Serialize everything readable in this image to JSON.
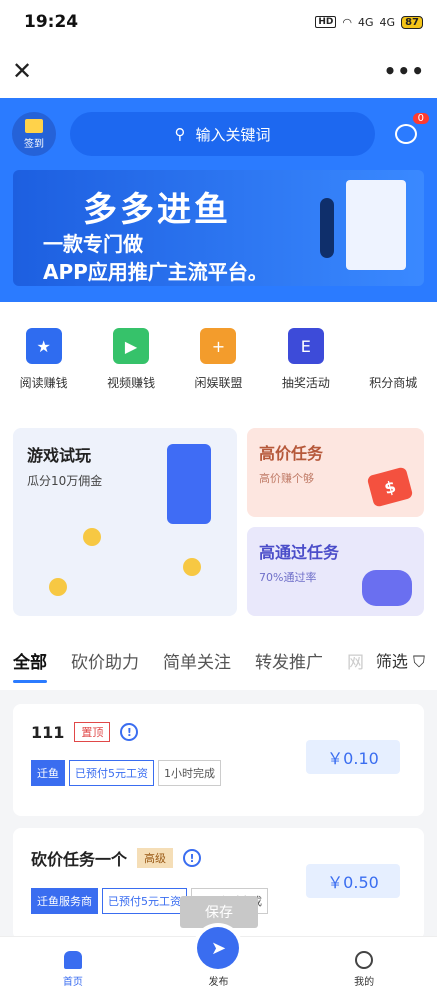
{
  "status": {
    "time": "19:24",
    "hd": "HD",
    "net1": "4G",
    "net2": "4G",
    "battery": "87"
  },
  "nav": {
    "close": "✕",
    "more": "•••"
  },
  "header": {
    "signin_label": "签到",
    "search_placeholder": "输入关键词",
    "msg_count": "0"
  },
  "banner": {
    "title": "多多进鱼",
    "line1": "一款专门做",
    "line2": "APP应用推广主流平台。"
  },
  "shortcuts": [
    {
      "label": "阅读赚钱",
      "color": "#2f6cf0"
    },
    {
      "label": "视频赚钱",
      "color": "#36c26a"
    },
    {
      "label": "闲娱联盟",
      "color": "#f39c2c"
    },
    {
      "label": "抽奖活动",
      "color": "#3d4bd9"
    },
    {
      "label": "积分商城",
      "color": "#ffffff"
    }
  ],
  "cards": {
    "game": {
      "title": "游戏试玩",
      "sub": "瓜分10万佣金"
    },
    "high": {
      "title": "高价任务",
      "sub": "高价赚个够",
      "icon": "$"
    },
    "pass": {
      "title": "高通过任务",
      "sub": "70%通过率"
    }
  },
  "tabs": [
    "全部",
    "砍价助力",
    "简单关注",
    "转发推广",
    "网"
  ],
  "filter_label": "筛选",
  "tasks": [
    {
      "title": "111",
      "badge": "置顶",
      "tags": [
        "迁鱼",
        "已预付5元工资",
        "1小时完成"
      ],
      "price": "￥0.10"
    },
    {
      "title": "砍价任务一个",
      "badge": "高级",
      "tags": [
        "迁鱼服务商",
        "已预付5元工资",
        "168小时完成"
      ],
      "price": "￥0.50"
    }
  ],
  "save_label": "保存",
  "bottom": {
    "home": "首页",
    "publish": "发布",
    "me": "我的"
  }
}
